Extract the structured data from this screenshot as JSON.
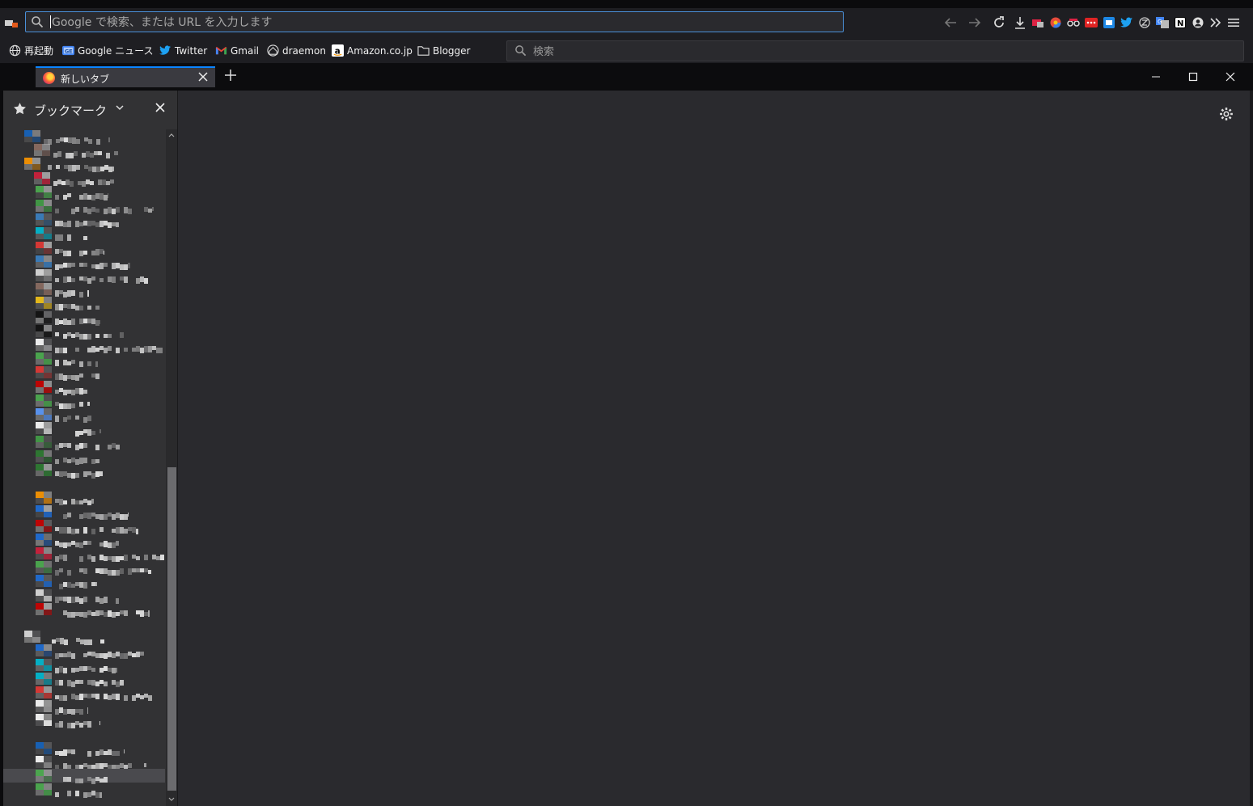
{
  "browser": {
    "url_placeholder": "Google で検索、または URL を入力します",
    "search_placeholder": "検索",
    "accent_color": "#0a84ff"
  },
  "bookmarks_toolbar": [
    {
      "label": "再起動",
      "icon": "globe-icon"
    },
    {
      "label": "Google ニュース",
      "icon": "google-news-icon"
    },
    {
      "label": "Twitter",
      "icon": "twitter-icon"
    },
    {
      "label": "Gmail",
      "icon": "gmail-icon"
    },
    {
      "label": "draemon",
      "icon": "draemon-icon"
    },
    {
      "label": "Amazon.co.jp",
      "icon": "amazon-icon"
    },
    {
      "label": "Blogger",
      "icon": "folder-icon"
    }
  ],
  "tabs": [
    {
      "label": "新しいタブ",
      "active": true
    }
  ],
  "sidebar": {
    "title": "ブックマーク"
  }
}
